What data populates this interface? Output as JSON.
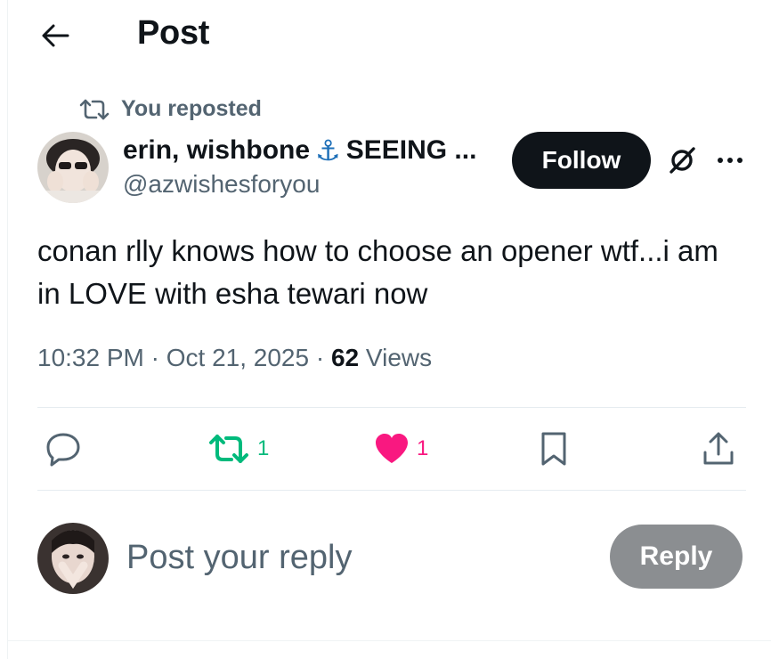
{
  "header": {
    "title": "Post",
    "back_icon": "arrow-left-icon"
  },
  "repost_context": {
    "label": "You reposted",
    "icon": "repost-icon"
  },
  "author": {
    "name": "erin, wishbone",
    "emoji": "⚓",
    "name_suffix": "SEEING ...",
    "handle": "@azwishesforyou",
    "avatar": "avatar-photo"
  },
  "follow_button": {
    "label": "Follow"
  },
  "post": {
    "text": "conan rlly knows how to choose an opener wtf...i am in LOVE with esha tewari now"
  },
  "meta": {
    "time": "10:32 PM",
    "separator": "·",
    "date": "Oct 21, 2025",
    "views_count": "62",
    "views_label": "Views"
  },
  "actions": {
    "reply": {
      "icon": "comment-icon",
      "count": ""
    },
    "repost": {
      "icon": "repost-icon",
      "count": "1",
      "color": "#00ba7c"
    },
    "like": {
      "icon": "heart-icon",
      "count": "1",
      "color": "#f91880"
    },
    "bookmark": {
      "icon": "bookmark-icon"
    },
    "share": {
      "icon": "share-icon"
    }
  },
  "reply_composer": {
    "placeholder": "Post your reply",
    "button_label": "Reply"
  },
  "colors": {
    "text_primary": "#0f1419",
    "text_secondary": "#536471",
    "follow_bg": "#0f1419",
    "reply_btn_disabled": "#8b8e91"
  }
}
